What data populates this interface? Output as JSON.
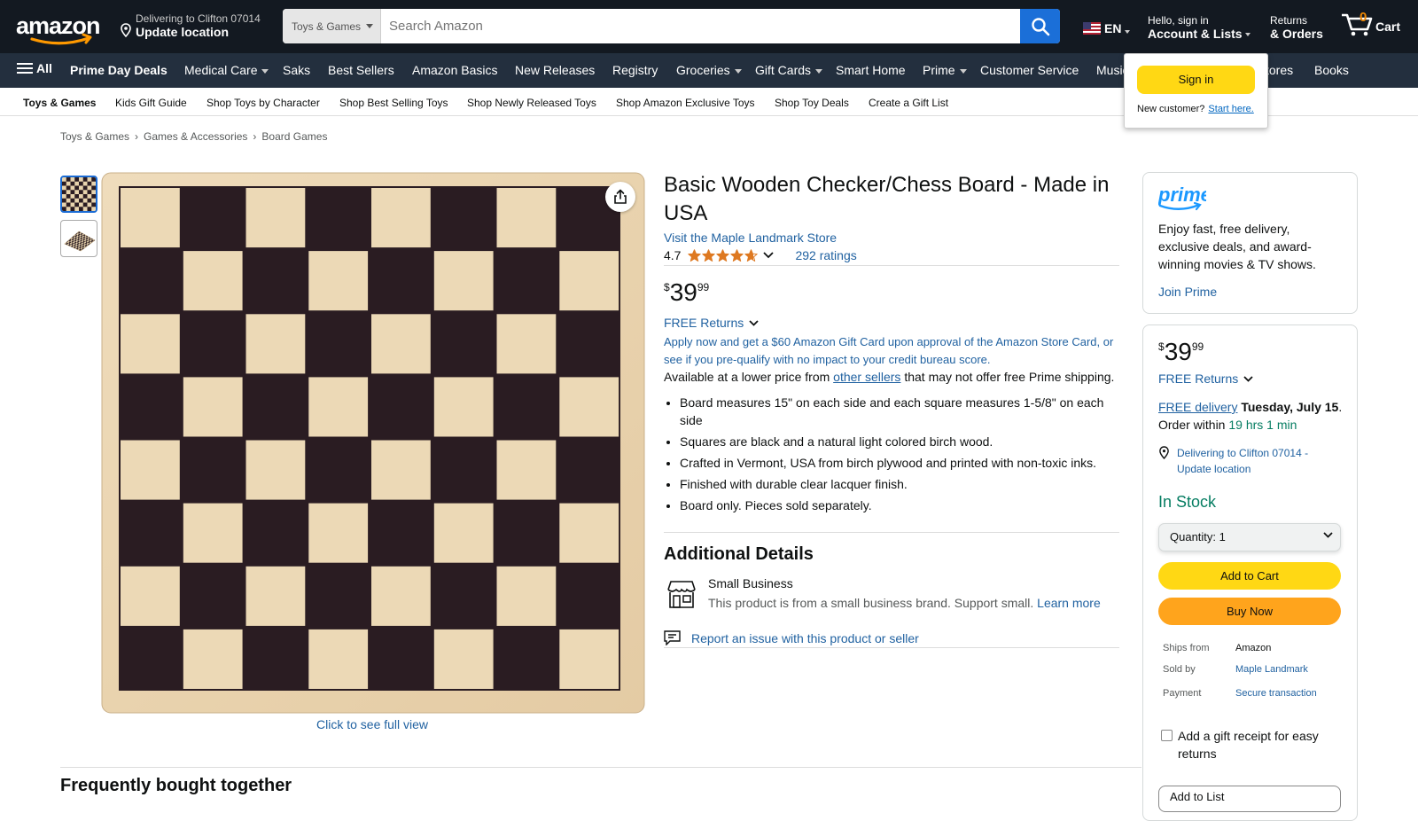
{
  "header": {
    "deliver_line1": "Delivering to Clifton 07014",
    "deliver_line2": "Update location",
    "search_category": "Toys & Games",
    "search_placeholder": "Search Amazon",
    "language": "EN",
    "account_line1": "Hello, sign in",
    "account_line2": "Account & Lists",
    "returns_line1": "Returns",
    "returns_line2": "& Orders",
    "cart_count": "0",
    "cart_label": "Cart"
  },
  "main_nav": {
    "all_label": "All",
    "items": [
      "Prime Day Deals",
      "Medical Care",
      "Saks",
      "Best Sellers",
      "Amazon Basics",
      "New Releases",
      "Registry",
      "Groceries",
      "Gift Cards",
      "Smart Home",
      "Prime",
      "Customer Service",
      "Music",
      "tores",
      "Books"
    ]
  },
  "sub_nav": {
    "items": [
      "Toys & Games",
      "Kids Gift Guide",
      "Shop Toys by Character",
      "Shop Best Selling Toys",
      "Shop Newly Released Toys",
      "Shop Amazon Exclusive Toys",
      "Shop Toy Deals",
      "Create a Gift List"
    ]
  },
  "signin_flyout": {
    "button": "Sign in",
    "new_customer": "New customer?",
    "start_here": "Start here."
  },
  "breadcrumb": [
    "Toys & Games",
    "Games & Accessories",
    "Board Games"
  ],
  "gallery": {
    "full_view": "Click to see full view"
  },
  "product": {
    "title": "Basic Wooden Checker/Chess Board - Made in USA",
    "store_link": "Visit the Maple Landmark Store",
    "rating": "4.7",
    "rating_count": "292 ratings",
    "price_symbol": "$",
    "price_whole": "39",
    "price_fraction": "99",
    "free_returns": "FREE Returns",
    "promo": "Apply now and get a $60 Amazon Gift Card upon approval of the Amazon Store Card, or see if you pre-qualify with no impact to your credit bureau score.",
    "lower_price_prefix": "Available at a lower price from",
    "lower_price_link": "other sellers",
    "lower_price_suffix": "that may not offer free Prime shipping.",
    "bullets": [
      "Board measures 15\" on each side and each square measures 1-5/8\" on each side",
      "Squares are black and a natural light colored birch wood.",
      "Crafted in Vermont, USA from birch plywood and printed with non-toxic inks.",
      "Finished with durable clear lacquer finish.",
      "Board only. Pieces sold separately."
    ],
    "additional_details": "Additional Details",
    "small_business_title": "Small Business",
    "small_business_desc": "This product is from a small business brand. Support small.",
    "learn_more": "Learn more",
    "report": "Report an issue with this product or seller"
  },
  "prime_box": {
    "logo": "prime",
    "description": "Enjoy fast, free delivery, exclusive deals, and award-winning movies & TV shows.",
    "join": "Join Prime"
  },
  "buy_box": {
    "price_symbol": "$",
    "price_whole": "39",
    "price_fraction": "99",
    "free_returns": "FREE Returns",
    "free_delivery": "FREE delivery",
    "delivery_date": "Tuesday, July 15",
    "order_within": ". Order within",
    "time_left": "19 hrs 1 min",
    "location": "Delivering to Clifton 07014 - Update location",
    "in_stock": "In Stock",
    "quantity_label": "Quantity:",
    "quantity_value": "1",
    "add_to_cart": "Add to Cart",
    "buy_now": "Buy Now",
    "ships_from_label": "Ships from",
    "ships_from_value": "Amazon",
    "sold_by_label": "Sold by",
    "sold_by_value": "Maple Landmark",
    "payment_label": "Payment",
    "payment_value": "Secure transaction",
    "gift_receipt": "Add a gift receipt for easy returns",
    "add_to_list": "Add to List"
  },
  "fbt_title": "Frequently bought together",
  "colors": {
    "nav_dark": "#131921",
    "nav_secondary": "#232f3e",
    "link_blue": "#2162a1",
    "in_stock_green": "#067d62",
    "button_yellow": "#ffd814",
    "button_orange": "#ffa41c",
    "star_orange": "#de7921"
  }
}
